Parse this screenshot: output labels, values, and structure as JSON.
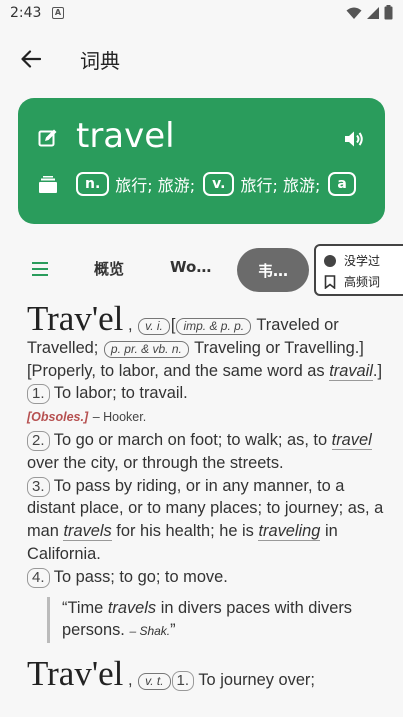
{
  "status_bar": {
    "time": "2:43",
    "notif_letter": "A"
  },
  "app_bar": {
    "title": "词典"
  },
  "word_card": {
    "word": "travel",
    "meanings": [
      {
        "pos": "n.",
        "text": "旅行; 旅游;"
      },
      {
        "pos": "v.",
        "text": "旅行; 旅游;"
      },
      {
        "pos": "a",
        "text": ""
      }
    ]
  },
  "tabs": {
    "overview": "概览",
    "wordnet": "Wo…",
    "webster": "韦…"
  },
  "study_panel": {
    "not_learned": "没学过",
    "high_freq": "高频词"
  },
  "content": {
    "e1_head": "Trav'el",
    "e1_comma": ",",
    "e1_chip_vi": "v. i.",
    "e1_bracket": "[",
    "e1_chip_imp": "imp. & p. p.",
    "e1_t1": "Traveled or Travelled;",
    "e1_chip_ppr": "p. pr. & vb. n.",
    "e1_t2": "Traveling or Travelling.] [Properly, to labor, and the same word as",
    "e1_travail": "travail",
    "e1_t3": ".]",
    "n1": "1.",
    "d1": "To labor; to travail.",
    "obs": "[Obsoles.]",
    "hooker": "– Hooker.",
    "n2": "2.",
    "d2a": "To go or march on foot; to walk; as, to",
    "d2_travel": "travel",
    "d2b": "over the city, or through the streets.",
    "n3": "3.",
    "d3a": "To pass by riding, or in any manner, to a distant place, or to many places; to journey; as, a man",
    "d3_travels": "travels",
    "d3b": "for his health; he is",
    "d3_traveling": "traveling",
    "d3c": "in California.",
    "n4": "4.",
    "d4": "To pass; to go; to move.",
    "q_open": "“Time",
    "q_travels": "travels",
    "q_rest": "in divers paces with divers persons.",
    "q_shak": "– Shak.",
    "q_close": "”",
    "e2_head": "Trav'el",
    "e2_comma": ",",
    "e2_chip_vt": "v. t.",
    "e2_n1": "1.",
    "e2_d1": "To journey over;"
  },
  "colors": {
    "card_green": "#2a9c5c",
    "active_tab": "#6b6b6b",
    "obsolete_red": "#b65050"
  },
  "icons": [
    "back-arrow-icon",
    "edit-icon",
    "speaker-icon",
    "book-icon",
    "menu-icon",
    "wifi-icon",
    "signal-icon",
    "battery-icon",
    "bookmark-icon"
  ]
}
